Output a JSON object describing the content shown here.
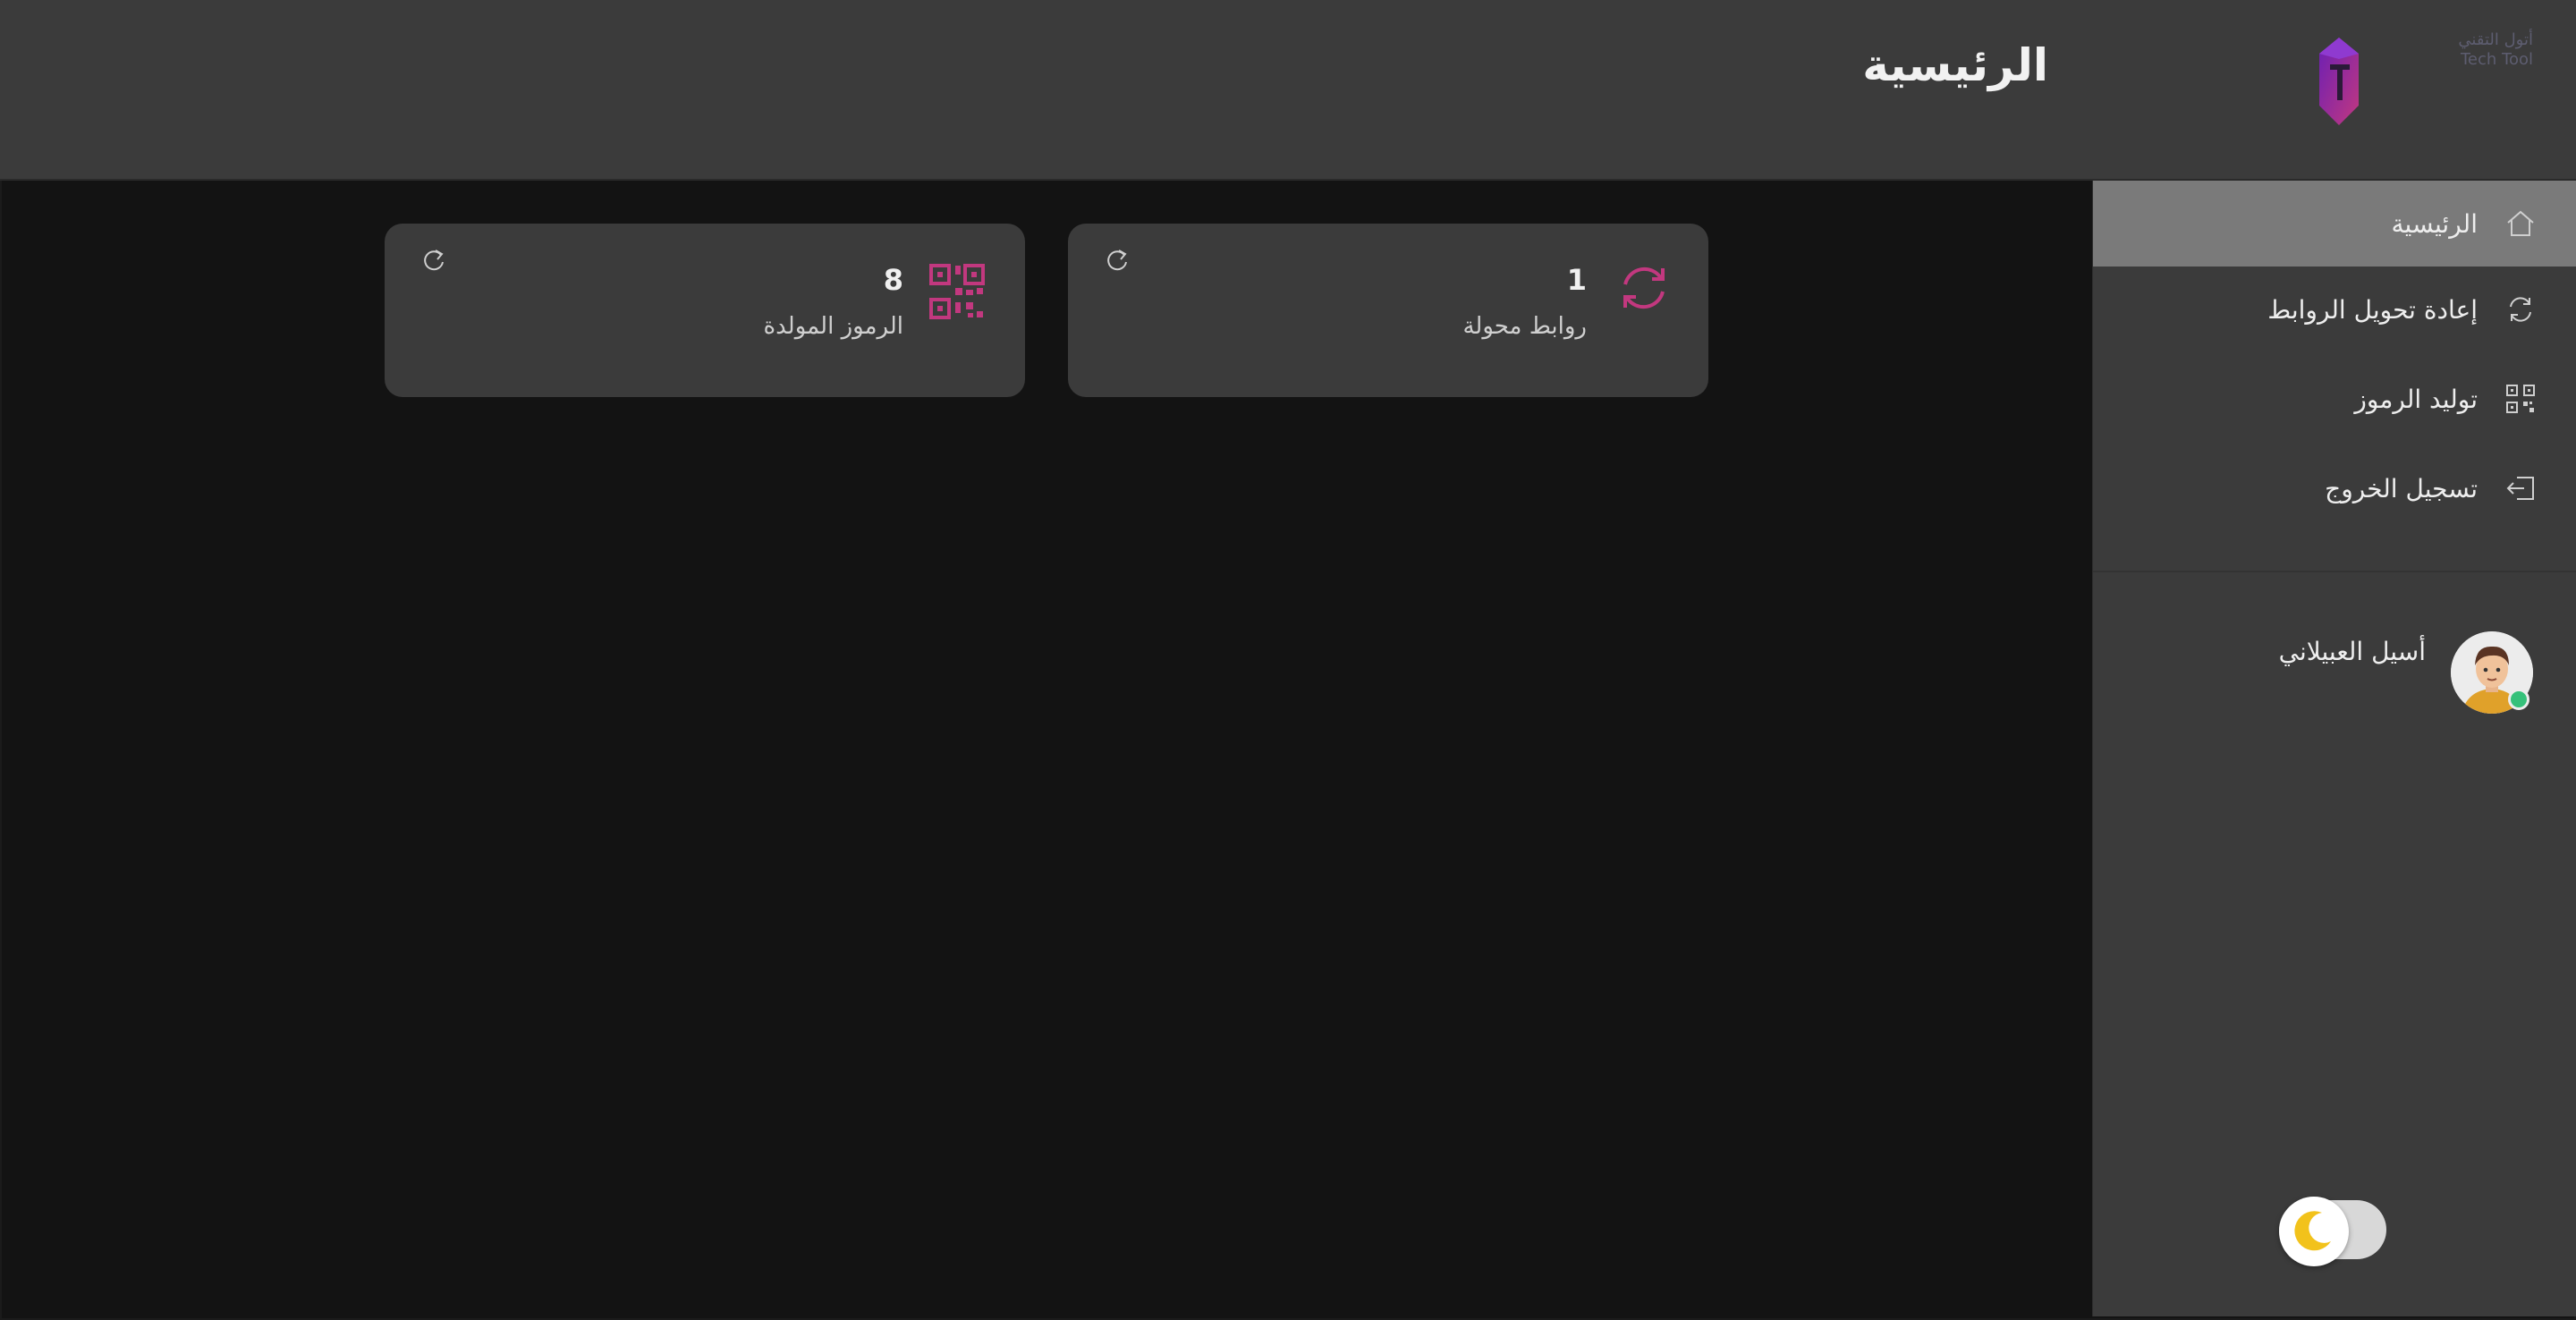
{
  "header": {
    "title": "الرئيسية",
    "logo_text": [
      "أتول التقني",
      "Tech Tool"
    ],
    "logo_icon": "crystal-logo-icon"
  },
  "sidebar": {
    "items": [
      {
        "label": "الرئيسية",
        "icon": "home-icon",
        "active": true
      },
      {
        "label": "إعادة تحويل الروابط",
        "icon": "sync-icon",
        "active": false
      },
      {
        "label": "توليد الرموز",
        "icon": "qr-code-icon",
        "active": false
      },
      {
        "label": "تسجيل الخروج",
        "icon": "logout-icon",
        "active": false
      }
    ],
    "user": {
      "name": "أسيل العبيلاني",
      "status": "online"
    },
    "theme_toggle": {
      "mode": "dark",
      "icon": "moon-icon"
    }
  },
  "cards": [
    {
      "value": "1",
      "label": "روابط محولة",
      "icon": "sync-icon"
    },
    {
      "value": "8",
      "label": "الرموز المولدة",
      "icon": "qr-code-icon"
    }
  ],
  "colors": {
    "accent": "#c2387f",
    "header_bg": "#3b3b3b",
    "sidebar_bg": "#3b3b3b",
    "active_item": "#7a7a7a",
    "page_bg": "#131313",
    "online": "#35c17a",
    "moon": "#f2c21b"
  }
}
